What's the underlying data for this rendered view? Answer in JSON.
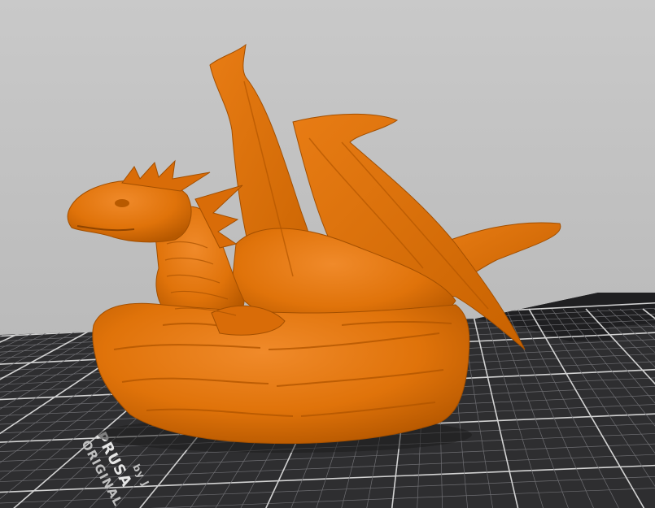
{
  "viewport": {
    "background_top": "#c9c9c9",
    "background_bottom": "#b3b3b3"
  },
  "bed": {
    "brand_line_1": "ORIGINAL",
    "brand_line_2": "PRUSA",
    "brand_line_3": "by J",
    "surface_color": "#2e2e30",
    "grid_color": "#6e6e72",
    "major_grid_color": "#d2d2d2"
  },
  "model": {
    "name": "dragon",
    "color": "#e0730a",
    "shadow_color": "#a04a00",
    "highlight_color": "#f08a2a"
  }
}
